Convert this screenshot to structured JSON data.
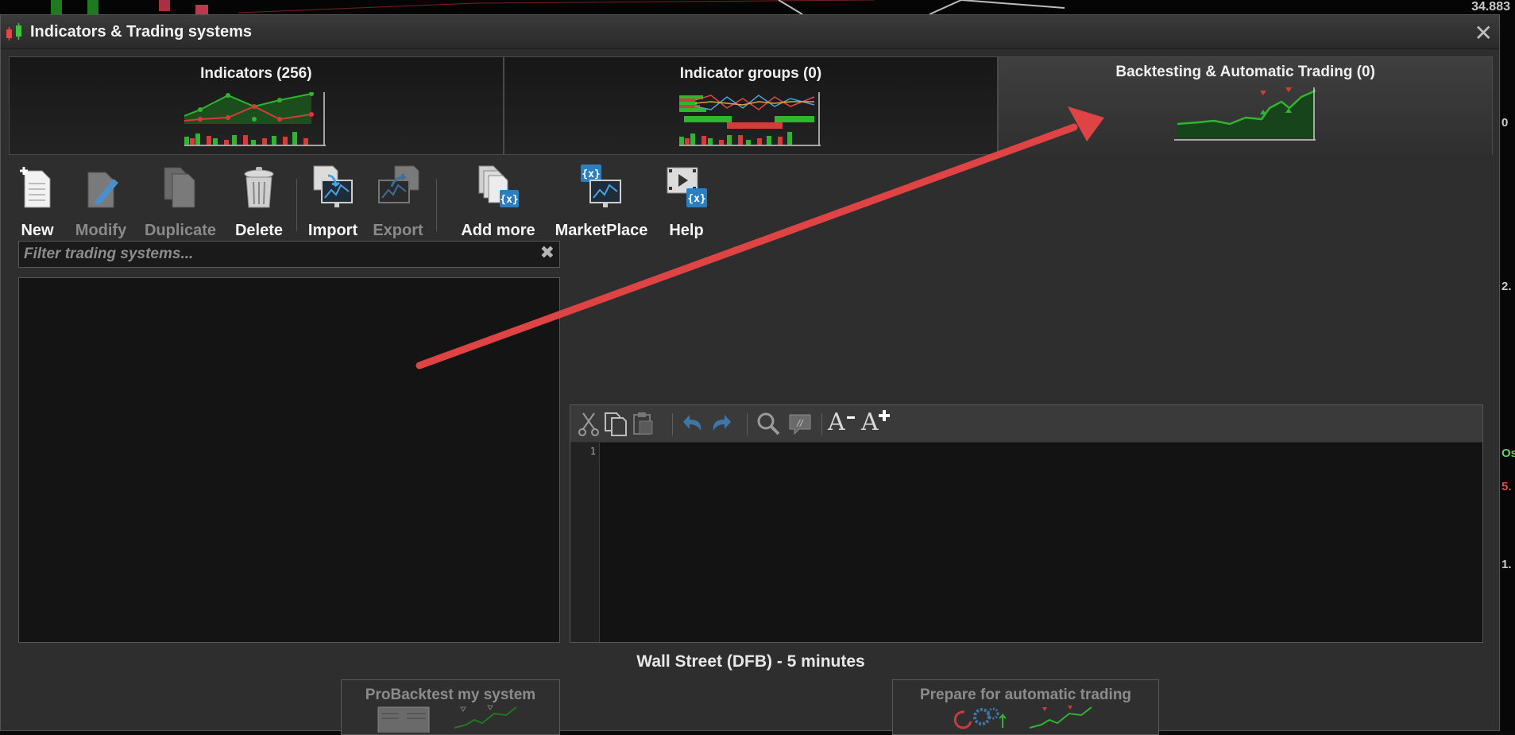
{
  "background": {
    "price_label": "34.883",
    "right_edge_labels": [
      "0",
      "2.",
      "Os",
      "5.",
      "1."
    ]
  },
  "window": {
    "title": "Indicators & Trading systems",
    "close_glyph": "✕"
  },
  "tabs": [
    {
      "label": "Indicators (256)",
      "active": false,
      "icon": "indicators-chart-icon"
    },
    {
      "label": "Indicator groups (0)",
      "active": false,
      "icon": "indicator-groups-chart-icon"
    },
    {
      "label": "Backtesting & Automatic Trading (0)",
      "active": true,
      "icon": "backtesting-chart-icon"
    }
  ],
  "toolbar": {
    "new": "New",
    "modify": "Modify",
    "duplicate": "Duplicate",
    "delete": "Delete",
    "import": "Import",
    "export": "Export",
    "add_more": "Add more",
    "marketplace": "MarketPlace",
    "help": "Help"
  },
  "filter": {
    "placeholder": "Filter trading systems...",
    "value": "",
    "clear_glyph": "✖"
  },
  "editor": {
    "line_numbers": [
      "1"
    ],
    "content": "",
    "font_decrease": "A",
    "font_increase": "A"
  },
  "instrument": "Wall Street (DFB) - 5 minutes",
  "actions": {
    "probacktest": "ProBacktest my system",
    "prepare_auto": "Prepare for automatic trading"
  },
  "colors": {
    "annotation_arrow": "#e04343",
    "chart_green": "#2fb52f",
    "chart_red": "#d83a3a",
    "accent_blue": "#2a7fc0"
  }
}
